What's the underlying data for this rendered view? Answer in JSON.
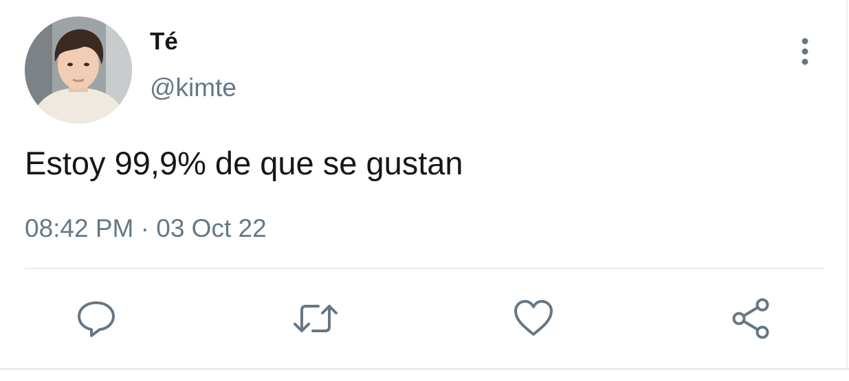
{
  "tweet": {
    "display_name": "Té",
    "handle": "@kimte",
    "text": "Estoy 99,9% de que se gustan",
    "timestamp": "08:42 PM · 03 Oct 22"
  },
  "actions": [
    {
      "icon": "reply-icon"
    },
    {
      "icon": "retweet-icon"
    },
    {
      "icon": "like-icon"
    },
    {
      "icon": "share-icon"
    }
  ],
  "colors": {
    "text_primary": "#14171a",
    "text_secondary": "#657786",
    "icon": "#657786",
    "divider": "#e6ecf0"
  }
}
